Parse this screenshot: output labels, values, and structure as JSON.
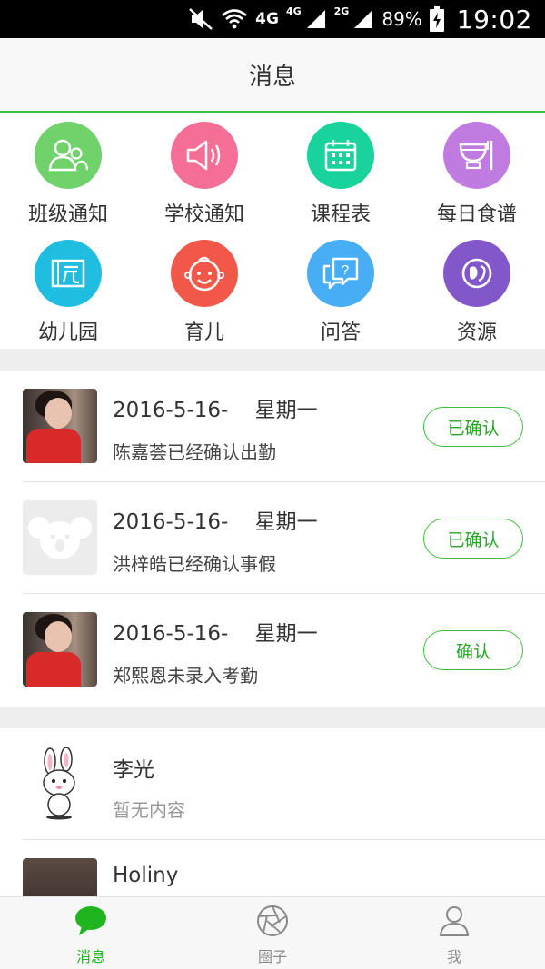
{
  "status_bar": {
    "network_primary": "4G",
    "network_secondary_1": "4G",
    "network_secondary_2": "2G",
    "battery": "89%",
    "time": "19:02"
  },
  "header": {
    "title": "消息"
  },
  "features": [
    {
      "label": "班级通知",
      "icon": "class-notice-icon",
      "color": "#6fd26a"
    },
    {
      "label": "学校通知",
      "icon": "speaker-icon",
      "color": "#f46e95"
    },
    {
      "label": "课程表",
      "icon": "calendar-icon",
      "color": "#19d29c"
    },
    {
      "label": "每日食谱",
      "icon": "bowl-icon",
      "color": "#c07be0"
    },
    {
      "label": "幼儿园",
      "icon": "kindergarten-icon",
      "color": "#1fbde0"
    },
    {
      "label": "育儿",
      "icon": "baby-face-icon",
      "color": "#f2584a"
    },
    {
      "label": "问答",
      "icon": "qa-icon",
      "color": "#47adf5"
    },
    {
      "label": "资源",
      "icon": "resource-icon",
      "color": "#8157c9"
    }
  ],
  "attendance": [
    {
      "date": "2016-5-16-    星期一",
      "desc": "陈嘉荟已经确认出勤",
      "button": "已确认",
      "avatar": "photo-girl"
    },
    {
      "date": "2016-5-16-    星期一",
      "desc": "洪梓皓已经确认事假",
      "button": "已确认",
      "avatar": "koala-placeholder"
    },
    {
      "date": "2016-5-16-    星期一",
      "desc": "郑熙恩未录入考勤",
      "button": "确认",
      "avatar": "photo-girl"
    }
  ],
  "chats": [
    {
      "name": "李光",
      "preview": "暂无内容",
      "avatar": "bunny-sticker"
    },
    {
      "name": "Holiny",
      "preview": "",
      "avatar": "photo-dark"
    }
  ],
  "tabs": [
    {
      "label": "消息",
      "icon": "chat-bubble-icon",
      "active": true
    },
    {
      "label": "圈子",
      "icon": "aperture-icon",
      "active": false
    },
    {
      "label": "我",
      "icon": "person-icon",
      "active": false
    }
  ],
  "colors": {
    "accent": "#3fbf3f",
    "tab_active": "#1fb51f",
    "band": "#eeeeee"
  }
}
